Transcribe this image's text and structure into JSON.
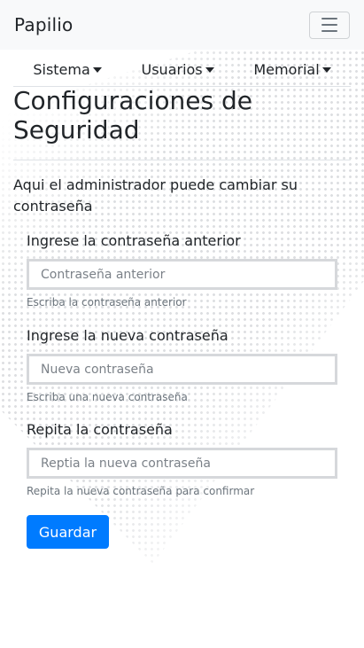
{
  "navbar": {
    "brand": "Papilio",
    "toggler_icon": "hamburger-menu-icon"
  },
  "menu": {
    "items": [
      {
        "label": "Sistema"
      },
      {
        "label": "Usuarios"
      },
      {
        "label": "Memorial"
      }
    ]
  },
  "page": {
    "title": "Configuraciones de Seguridad",
    "intro": "Aqui el administrador puede cambiar su contraseña"
  },
  "form": {
    "fields": [
      {
        "label": "Ingrese la contraseña anterior",
        "placeholder": "Contraseña anterior",
        "value": "",
        "help": "Escriba la contraseña anterior"
      },
      {
        "label": "Ingrese la nueva contraseña",
        "placeholder": "Nueva contraseña",
        "value": "",
        "help": "Escriba una nueva contraseña"
      },
      {
        "label": "Repita la contraseña",
        "placeholder": "Reptia la nueva contraseña",
        "value": "",
        "help": "Repita la nueva contraseña para confirmar"
      }
    ],
    "submit_label": "Guardar"
  },
  "colors": {
    "primary": "#007bff",
    "navbar_bg": "#f8f9fa",
    "text": "#212529",
    "muted": "#6c757d"
  }
}
